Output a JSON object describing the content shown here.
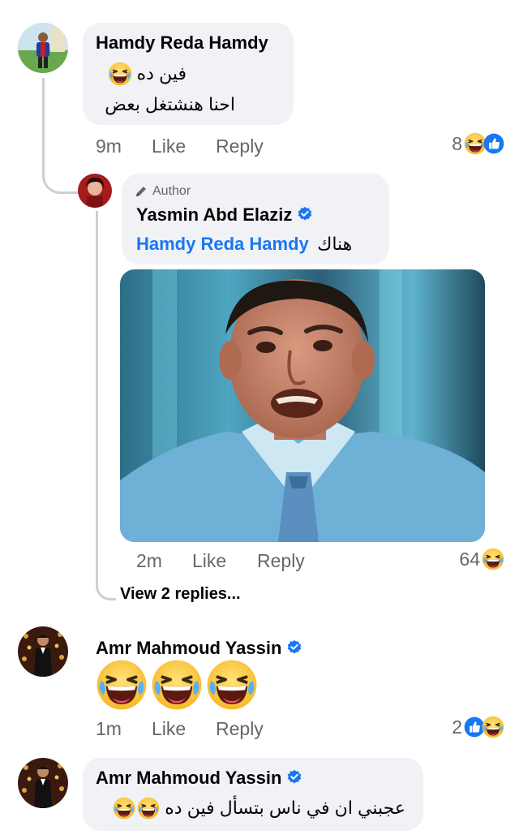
{
  "comments": [
    {
      "author": "Hamdy Reda Hamdy",
      "line1": "فين ده",
      "line2": "احنا هنشتغل بعض",
      "time": "9m",
      "like": "Like",
      "reply": "Reply",
      "reaction_count": "8"
    },
    {
      "badge": "Author",
      "author": "Yasmin Abd Elaziz",
      "mention": "Hamdy Reda Hamdy",
      "text": "هناك",
      "time": "2m",
      "like": "Like",
      "reply": "Reply",
      "reaction_count": "64",
      "view_replies": "View 2 replies..."
    },
    {
      "author": "Amr Mahmoud Yassin",
      "time": "1m",
      "like": "Like",
      "reply": "Reply",
      "reaction_count": "2"
    },
    {
      "author": "Amr Mahmoud Yassin",
      "text": "عجبني ان في ناس بتسأل فين ده"
    }
  ],
  "icons": {
    "laugh": "laughing-emoji-icon",
    "like": "like-reaction-icon",
    "verified": "verified-badge-icon",
    "pencil": "pencil-icon"
  },
  "colors": {
    "accent": "#1877f2",
    "bubble": "#f0f2f5",
    "meta": "#65676b"
  }
}
